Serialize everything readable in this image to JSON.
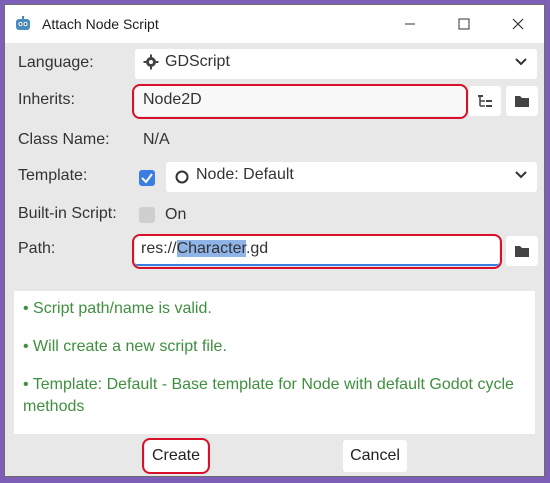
{
  "window": {
    "title": "Attach Node Script",
    "controls": {
      "minimize": "—",
      "maximize": "☐",
      "close": "✕"
    }
  },
  "form": {
    "language": {
      "label": "Language:",
      "value": "GDScript"
    },
    "inherits": {
      "label": "Inherits:",
      "value": "Node2D"
    },
    "class_name": {
      "label": "Class Name:",
      "value": "N/A"
    },
    "template": {
      "label": "Template:",
      "checked": true,
      "value": "Node: Default"
    },
    "builtin": {
      "label": "Built-in Script:",
      "checked": false,
      "value": "On"
    },
    "path": {
      "label": "Path:",
      "prefix": "res://",
      "selected": "Character",
      "suffix": ".gd"
    }
  },
  "info": {
    "lines": [
      "• Script path/name is valid.",
      "• Will create a new script file.",
      "• Template: Default - Base template for Node with default Godot cycle methods"
    ]
  },
  "buttons": {
    "create": "Create",
    "cancel": "Cancel"
  },
  "colors": {
    "highlight_box": "#d8102a",
    "checkbox_on": "#3a7de0",
    "info_text": "#3f8f3f",
    "background": "#7d5fb8"
  }
}
